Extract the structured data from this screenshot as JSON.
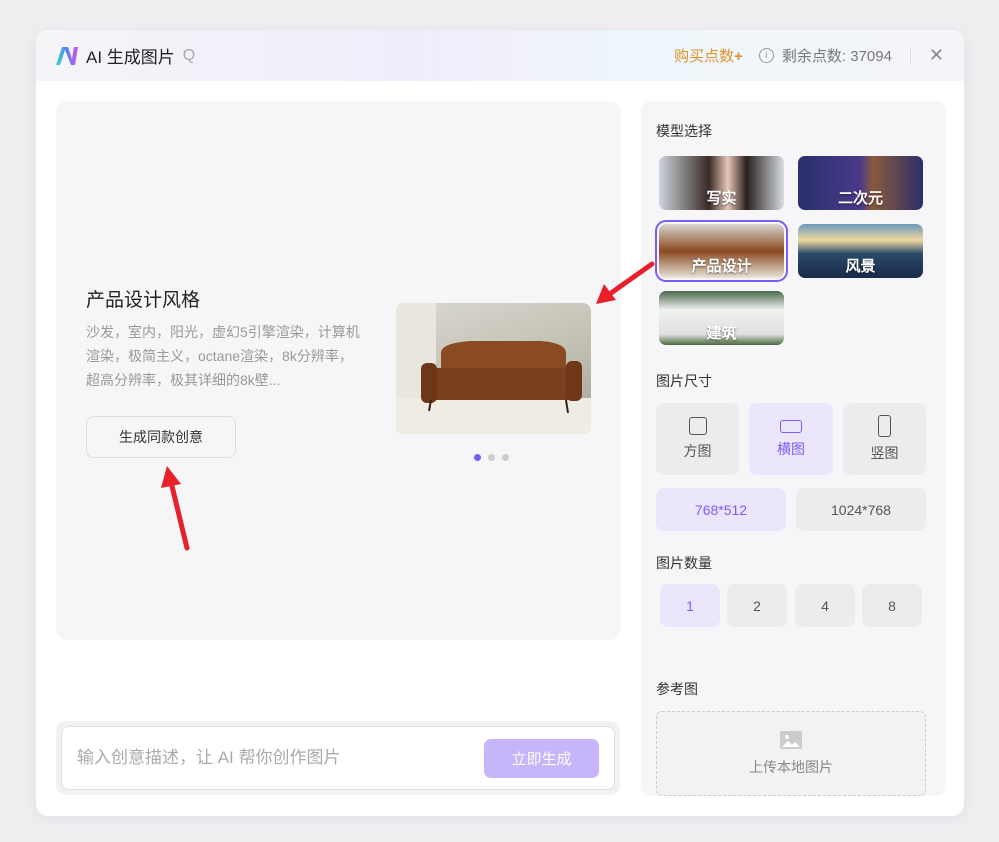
{
  "header": {
    "title": "AI 生成图片",
    "search_glyph": "Q",
    "buy_label": "购买点数",
    "buy_plus": "+",
    "remaining_label": "剩余点数: 37094",
    "close": "✕"
  },
  "preview": {
    "title": "产品设计风格",
    "description": "沙发，室内，阳光，虚幻5引擎渲染，计算机渲染，极简主义，octane渲染，8k分辨率，超高分辨率，极其详细的8k壁...",
    "button": "生成同款创意",
    "active_dot": 1,
    "dot_count": 3
  },
  "prompt": {
    "placeholder": "输入创意描述，让 AI 帮你创作图片",
    "value": "",
    "generate": "立即生成"
  },
  "panel": {
    "model_title": "模型选择",
    "models": [
      {
        "label": "写实"
      },
      {
        "label": "二次元"
      },
      {
        "label": "产品设计",
        "selected": true
      },
      {
        "label": "风景"
      },
      {
        "label": "建筑"
      }
    ],
    "size_title": "图片尺寸",
    "shapes": [
      {
        "label": "方图"
      },
      {
        "label": "横图",
        "selected": true
      },
      {
        "label": "竖图"
      }
    ],
    "resolutions": [
      {
        "label": "768*512",
        "selected": true
      },
      {
        "label": "1024*768"
      }
    ],
    "count_title": "图片数量",
    "counts": [
      {
        "label": "1",
        "selected": true
      },
      {
        "label": "2"
      },
      {
        "label": "4"
      },
      {
        "label": "8"
      }
    ],
    "ref_title": "参考图",
    "upload": "上传本地图片"
  },
  "colors": {
    "accent": "#7c5cf6",
    "buy": "#e0912a",
    "annotation": "#e8202a"
  }
}
